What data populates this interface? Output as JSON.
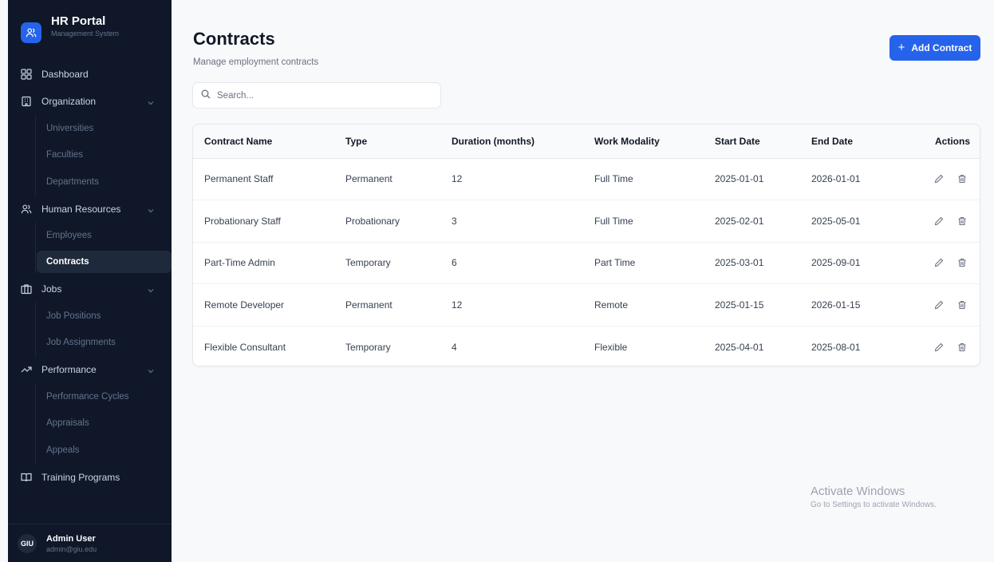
{
  "brand": {
    "title": "HR Portal",
    "subtitle": "Management System"
  },
  "sidebar": {
    "dashboard": "Dashboard",
    "organization": {
      "label": "Organization",
      "items": [
        "Universities",
        "Faculties",
        "Departments"
      ]
    },
    "human_resources": {
      "label": "Human Resources",
      "items": [
        "Employees",
        "Contracts"
      ]
    },
    "jobs": {
      "label": "Jobs",
      "items": [
        "Job Positions",
        "Job Assignments"
      ]
    },
    "performance": {
      "label": "Performance",
      "items": [
        "Performance Cycles",
        "Appraisals",
        "Appeals"
      ]
    },
    "training": "Training Programs",
    "active_item": "Contracts"
  },
  "user": {
    "initials": "GIU",
    "name": "Admin User",
    "email": "admin@giu.edu"
  },
  "page": {
    "title": "Contracts",
    "subtitle": "Manage employment contracts"
  },
  "toolbar": {
    "add_label": "Add Contract",
    "add_plus": "+"
  },
  "search": {
    "placeholder": "Search...",
    "value": ""
  },
  "table": {
    "headers": [
      "Contract Name",
      "Type",
      "Duration (months)",
      "Work Modality",
      "Start Date",
      "End Date",
      "Actions"
    ],
    "rows": [
      [
        "Permanent Staff",
        "Permanent",
        "12",
        "Full Time",
        "2025-01-01",
        "2026-01-01"
      ],
      [
        "Probationary Staff",
        "Probationary",
        "3",
        "Full Time",
        "2025-02-01",
        "2025-05-01"
      ],
      [
        "Part-Time Admin",
        "Temporary",
        "6",
        "Part Time",
        "2025-03-01",
        "2025-09-01"
      ],
      [
        "Remote Developer",
        "Permanent",
        "12",
        "Remote",
        "2025-01-15",
        "2026-01-15"
      ],
      [
        "Flexible Consultant",
        "Temporary",
        "4",
        "Flexible",
        "2025-04-01",
        "2025-08-01"
      ]
    ]
  },
  "watermark": {
    "title": "Activate Windows",
    "subtitle": "Go to Settings to activate Windows."
  },
  "colors": {
    "accent": "#2563eb",
    "sidebar_bg": "#0f1729",
    "page_bg": "#f8f9fb"
  },
  "icons": {
    "edit": "pencil-icon",
    "delete": "trash-icon",
    "search": "search-icon"
  }
}
